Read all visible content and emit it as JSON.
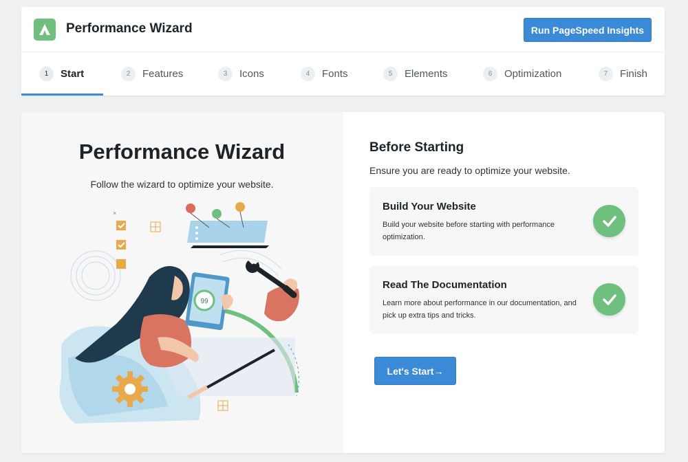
{
  "header": {
    "logo_icon": "brand-logo-icon",
    "title": "Performance Wizard",
    "psi_button_label": "Run PageSpeed Insights",
    "accent_color": "#3b8ad8"
  },
  "steps": [
    {
      "num": "1",
      "label": "Start",
      "active": true
    },
    {
      "num": "2",
      "label": "Features"
    },
    {
      "num": "3",
      "label": "Icons"
    },
    {
      "num": "4",
      "label": "Fonts"
    },
    {
      "num": "5",
      "label": "Elements"
    },
    {
      "num": "6",
      "label": "Optimization"
    },
    {
      "num": "7",
      "label": "Finish"
    }
  ],
  "hero": {
    "title": "Performance Wizard",
    "subtitle": "Follow the wizard to optimize your website.",
    "illustration_score": "99"
  },
  "before": {
    "title": "Before Starting",
    "subtitle": "Ensure you are ready to optimize your website.",
    "items": [
      {
        "title": "Build Your Website",
        "desc": "Build your website before starting with performance optimization.",
        "icon": "check-icon",
        "color": "#6fbf7f"
      },
      {
        "title": "Read The Documentation",
        "desc": "Learn more about performance in our documentation, and pick up extra tips and tricks.",
        "icon": "check-icon",
        "color": "#6fbf7f"
      }
    ],
    "start_label": "Let's Start→"
  }
}
